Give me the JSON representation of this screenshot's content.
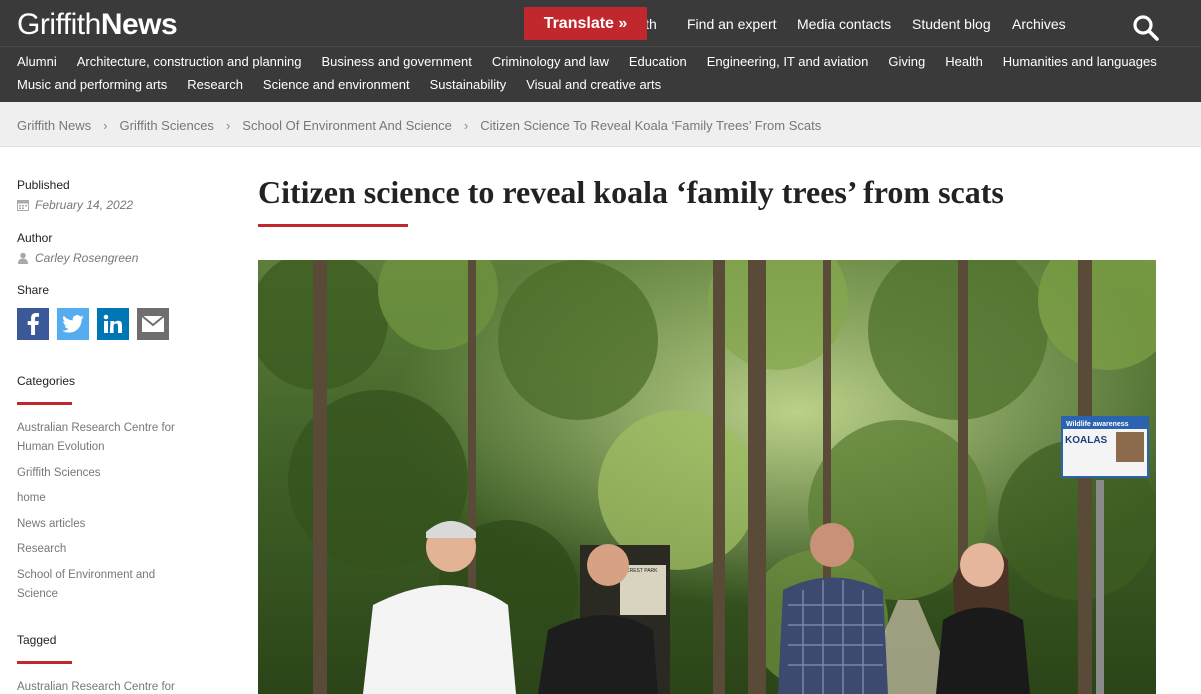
{
  "header": {
    "logo_part1": "Griffith",
    "logo_part2": "News",
    "translate_label": "Translate »",
    "nav": [
      "ith",
      "Find an expert",
      "Media contacts",
      "Student blog",
      "Archives"
    ],
    "search_icon": "search-icon"
  },
  "categories_nav": {
    "row1": [
      "Alumni",
      "Architecture, construction and planning",
      "Business and government",
      "Criminology and law",
      "Education",
      "Engineering, IT and aviation",
      "Giving",
      "Health",
      "Humanities and languages"
    ],
    "row2": [
      "Music and performing arts",
      "Research",
      "Science and environment",
      "Sustainability",
      "Visual and creative arts"
    ]
  },
  "breadcrumb": [
    "Griffith News",
    "Griffith Sciences",
    "School Of Environment And Science",
    "Citizen Science To Reveal Koala ‘Family Trees’ From Scats"
  ],
  "sidebar": {
    "published_label": "Published",
    "published_date": "February 14, 2022",
    "author_label": "Author",
    "author_name": "Carley Rosengreen",
    "share_label": "Share",
    "categories_label": "Categories",
    "categories": [
      "Australian Research Centre for Human Evolution",
      "Griffith Sciences",
      "home",
      "News articles",
      "Research",
      "School of Environment and Science"
    ],
    "tagged_label": "Tagged",
    "tags": [
      "Australian Research Centre for"
    ]
  },
  "article": {
    "title": "Citizen science to reveal koala ‘family trees’ from scats"
  },
  "photo": {
    "sign_title": "Wildlife awareness",
    "sign_text": "KOALAS",
    "board_text": "CREST PARK"
  },
  "colors": {
    "header_bg": "#3a3a3a",
    "accent_red": "#c0282d",
    "breadcrumb_bg": "#efefef"
  }
}
